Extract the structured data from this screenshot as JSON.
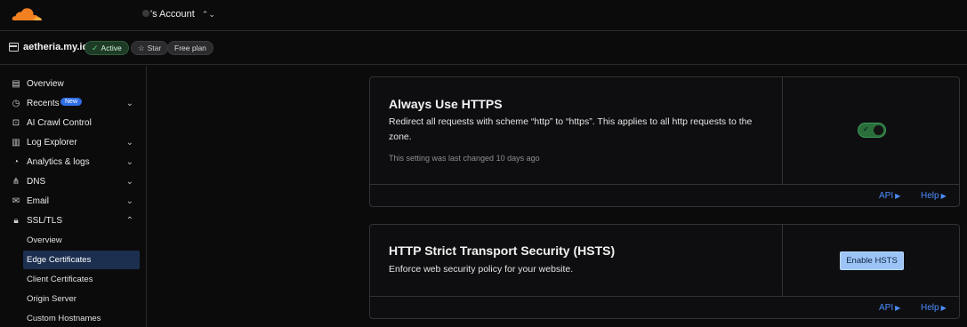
{
  "topbar": {
    "account_label": "'s Account",
    "switch_icon": "chevron-up-down-icon"
  },
  "zone": {
    "name": "aetheria.my.id",
    "status": "Active",
    "star_label": "Star",
    "plan": "Free plan"
  },
  "sidebar": {
    "items": [
      {
        "label": "Overview",
        "icon": "clipboard-icon"
      },
      {
        "label": "Recents",
        "icon": "clock-icon",
        "badge": "New",
        "chevron": "v"
      },
      {
        "label": "AI Crawl Control",
        "icon": "robot-icon"
      },
      {
        "label": "Log Explorer",
        "icon": "log-icon",
        "chevron": "v"
      },
      {
        "label": "Analytics & logs",
        "icon": "chart-icon",
        "chevron": "v"
      },
      {
        "label": "DNS",
        "icon": "network-icon",
        "chevron": "v"
      },
      {
        "label": "Email",
        "icon": "mail-icon",
        "chevron": "v"
      },
      {
        "label": "SSL/TLS",
        "icon": "lock-icon",
        "chevron": "^"
      }
    ],
    "ssl_subitems": [
      {
        "label": "Overview"
      },
      {
        "label": "Edge Certificates",
        "active": true
      },
      {
        "label": "Client Certificates"
      },
      {
        "label": "Origin Server"
      },
      {
        "label": "Custom Hostnames"
      }
    ]
  },
  "cards": {
    "https": {
      "title": "Always Use HTTPS",
      "description": "Redirect all requests with scheme “http” to “https”. This applies to all http requests to the zone.",
      "meta": "This setting was last changed 10 days ago",
      "toggle_on": true,
      "api_label": "API",
      "help_label": "Help"
    },
    "hsts": {
      "title": "HTTP Strict Transport Security (HSTS)",
      "description": "Enforce web security policy for your website.",
      "button_label": "Enable HSTS",
      "api_label": "API",
      "help_label": "Help"
    }
  },
  "colors": {
    "brand_orange": "#f38020",
    "link_blue": "#4b8dff",
    "active_green": "#2a6e3c",
    "active_nav": "#1c2f4f"
  }
}
